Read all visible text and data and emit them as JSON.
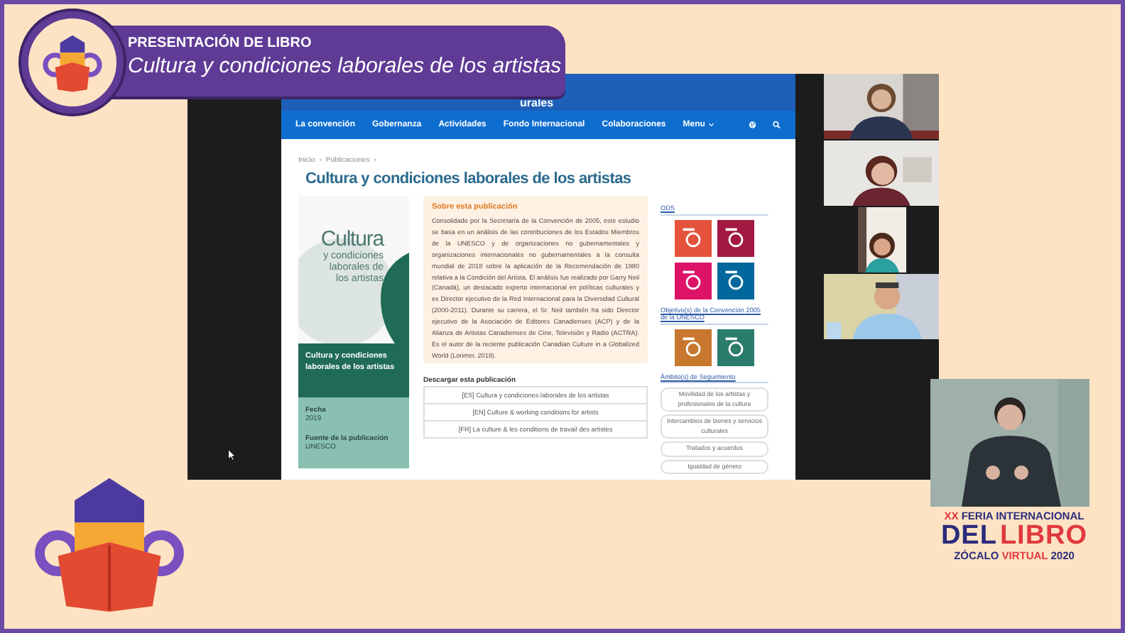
{
  "banner": {
    "kicker": "PRESENTACIÓN DE LIBRO",
    "title": "Cultura y condiciones laborales de los artistas"
  },
  "shared_screen": {
    "site_title": "urales",
    "nav": [
      {
        "label": "La convención"
      },
      {
        "label": "Gobernanza"
      },
      {
        "label": "Actividades"
      },
      {
        "label": "Fondo Internacional"
      },
      {
        "label": "Colaboraciones"
      }
    ],
    "menu": "Menu",
    "breadcrumb": [
      {
        "label": "Inicio"
      },
      {
        "label": "Publicaciones"
      }
    ],
    "breadcrumb_separator": "›",
    "title": "Cultura y condiciones laborales de los artistas",
    "cover": {
      "title_lines": [
        "Cultura",
        "y condiciones",
        "laborales de",
        "los artistas"
      ]
    },
    "info_box": {
      "title": "Cultura y condiciones laborales de los artistas",
      "fields": [
        {
          "label": "Fecha",
          "value": "2019"
        },
        {
          "label": "Fuente de la publicación",
          "value": "UNESCO"
        }
      ]
    },
    "about": {
      "heading": "Sobre esta publicación",
      "text": "Consolidado por la Secretaría de la Convención de 2005, este estudio se basa en un análisis de las contribuciones de los Estados Miembros de la UNESCO y de organizaciones no gubernamentales y organizaciones internacionales no gubernamentales a la consulta mundial de 2018 sobre la aplicación de la Recomendación de 1980 relativa a la Condición del Artista. El análisis fue realizado por Garry Neil (Canadá), un destacado experto internacional en políticas culturales y ex Director ejecutivo de la Red Internacional para la Diversidad Cultural (2000-2011). Durante su carrera, el Sr. Neil también ha sido Director ejecutivo de la Asociación de Editores Canadienses (ACP) y de la Alianza de Artistas Canadienses de Cine, Televisión y Radio (ACTRA). Es el autor de la reciente publicación Canadian Culture in a Globalized World (Lorimer, 2019)."
    },
    "download": {
      "heading": "Descargar esta publicación",
      "links": [
        {
          "label": "[ES] Cultura y condiciones laborales de los artistas"
        },
        {
          "label": "[EN] Culture & working conditions for artists"
        },
        {
          "label": "[FR] La culture & les conditions de travail des artistes"
        }
      ]
    },
    "sidebar": {
      "sections": [
        {
          "kind": "tiles",
          "heading": "ODS",
          "tiles": [
            {
              "color": "#e5533d"
            },
            {
              "color": "#a21942"
            },
            {
              "color": "#dd1367"
            },
            {
              "color": "#00689d"
            }
          ]
        },
        {
          "kind": "tiles",
          "heading": "Objetivo(s) de la Convención 2005 de la UNESCO",
          "tiles": [
            {
              "color": "#c8782e"
            },
            {
              "color": "#2b7d6b"
            }
          ]
        },
        {
          "kind": "tags",
          "heading": "Ámbito(s) de Seguimiento",
          "tags": [
            {
              "label": "Movilidad de los artistas y profesionales de la cultura"
            },
            {
              "label": "Intercambios de bienes y servicios culturales"
            },
            {
              "label": "Tratados y acuerdos"
            },
            {
              "label": "Igualdad de género"
            }
          ]
        }
      ]
    }
  },
  "fair_logo": {
    "lines": [
      {
        "parts": [
          {
            "text": "XX",
            "color": "#e0393e"
          },
          {
            "text": "FERIA INTERNACIONAL",
            "color": "#2b2b7c"
          }
        ]
      },
      {
        "parts": [
          {
            "text": "DEL",
            "color": "#2b2b7c"
          },
          {
            "text": "LIBRO",
            "color": "#e0393e"
          }
        ]
      },
      {
        "parts": [
          {
            "text": "ZÓCALO",
            "color": "#2b2b7c"
          },
          {
            "text": "VIRTUAL",
            "color": "#e0393e"
          },
          {
            "text": "2020",
            "color": "#2b2b7c"
          }
        ]
      }
    ]
  }
}
